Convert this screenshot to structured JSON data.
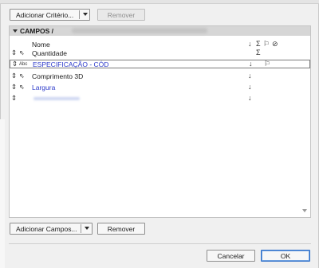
{
  "toolbar_top": {
    "add_criteria_label": "Adicionar Critério...",
    "remove_label": "Remover"
  },
  "section": {
    "title": "CAMPOS / "
  },
  "columns": {
    "name": "Nome",
    "sort_icon": "sort-arrow-icon",
    "sum_icon": "sum-icon",
    "flag_icon": "flag-icon",
    "hide_icon": "eye-slash-icon"
  },
  "rows": [
    {
      "label": "Quantidade",
      "type_icon": "arrow-cursor-icon",
      "color": "#1a1a1a",
      "sort": "",
      "sum": "Σ",
      "flag": ""
    },
    {
      "label": "ESPECIFICAÇÃO - CÓD",
      "type_icon": "abc-text-icon",
      "type_text": "Abc",
      "color": "#2b39c9",
      "sort": "↓",
      "sum": "",
      "flag": "⚐"
    },
    {
      "label": "Comprimento 3D",
      "type_icon": "arrow-cursor-icon",
      "color": "#1a1a1a",
      "sort": "↓",
      "sum": "",
      "flag": ""
    },
    {
      "label": "Largura",
      "type_icon": "arrow-cursor-icon",
      "color": "#2b39c9",
      "sort": "↓",
      "sum": "",
      "flag": ""
    },
    {
      "label": "",
      "type_icon": "",
      "color": "#2b39c9",
      "sort": "↓",
      "sum": "",
      "flag": ""
    }
  ],
  "glyphs": {
    "handle": "⇕",
    "cursor": "⇖",
    "abc": "Abc",
    "sort": "↓",
    "sum": "Σ",
    "flag": "⚐",
    "hide": "⊘"
  },
  "toolbar_bottom": {
    "add_fields_label": "Adicionar Campos...",
    "remove_label": "Remover"
  },
  "footer": {
    "cancel_label": "Cancelar",
    "ok_label": "OK"
  },
  "colors": {
    "link_blue": "#2b39c9",
    "header_gray": "#d6d6d6",
    "ok_border": "#2f6fc9"
  }
}
